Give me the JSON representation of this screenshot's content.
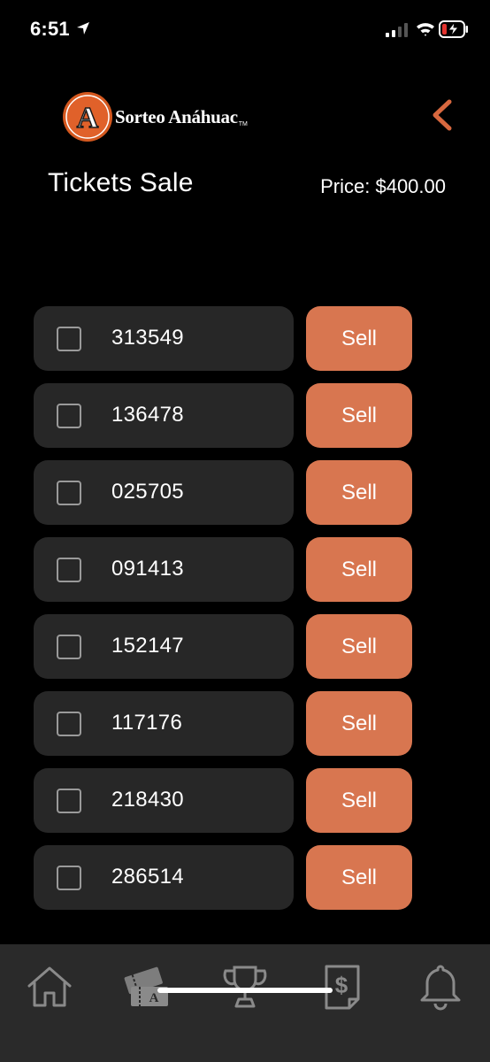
{
  "status_bar": {
    "time": "6:51"
  },
  "header": {
    "logo_text": "Sorteo Anáhuac",
    "logo_tm": "TM",
    "logo_letter": "A"
  },
  "title": "Tickets Sale",
  "price": "Price: $400.00",
  "tickets": [
    {
      "number": "313549",
      "sell_label": "Sell"
    },
    {
      "number": "136478",
      "sell_label": "Sell"
    },
    {
      "number": "025705",
      "sell_label": "Sell"
    },
    {
      "number": "091413",
      "sell_label": "Sell"
    },
    {
      "number": "152147",
      "sell_label": "Sell"
    },
    {
      "number": "117176",
      "sell_label": "Sell"
    },
    {
      "number": "218430",
      "sell_label": "Sell"
    },
    {
      "number": "286514",
      "sell_label": "Sell"
    }
  ],
  "tab_bar": {
    "tabs": [
      {
        "icon": "home-icon"
      },
      {
        "icon": "tickets-icon",
        "letter": "A"
      },
      {
        "icon": "trophy-icon"
      },
      {
        "icon": "receipt-dollar-icon",
        "symbol": "$"
      },
      {
        "icon": "bell-icon"
      }
    ]
  },
  "colors": {
    "background": "#000000",
    "accent": "#d87650",
    "card": "#272727",
    "tab_bar": "#2a2a2a"
  }
}
